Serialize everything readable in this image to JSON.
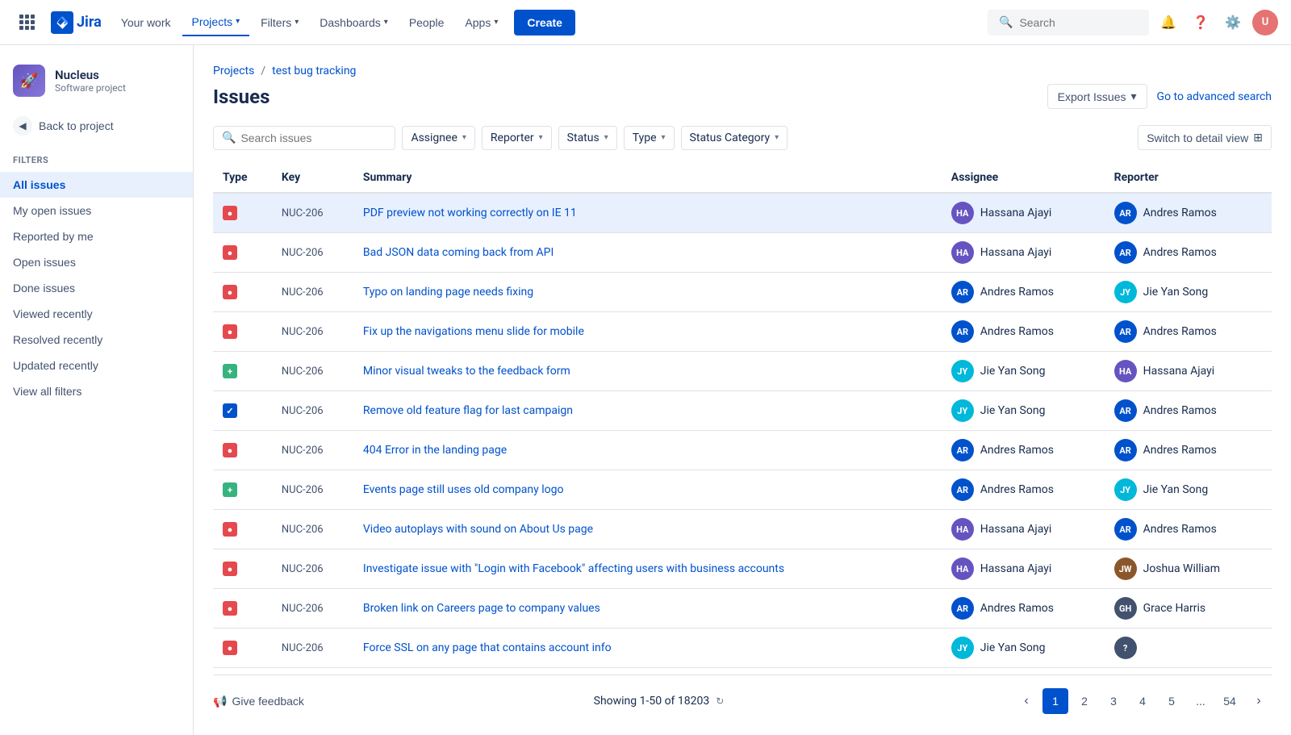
{
  "topnav": {
    "logo_text": "Jira",
    "nav_items": [
      {
        "label": "Your work",
        "active": false
      },
      {
        "label": "Projects",
        "active": true,
        "has_dropdown": true
      },
      {
        "label": "Filters",
        "active": false,
        "has_dropdown": true
      },
      {
        "label": "Dashboards",
        "active": false,
        "has_dropdown": true
      },
      {
        "label": "People",
        "active": false
      },
      {
        "label": "Apps",
        "active": false,
        "has_dropdown": true
      }
    ],
    "create_label": "Create",
    "search_placeholder": "Search",
    "search_label": "Search"
  },
  "sidebar": {
    "project_name": "Nucleus",
    "project_type": "Software project",
    "back_label": "Back to project",
    "section_label": "Filters",
    "items": [
      {
        "label": "All issues",
        "active": true
      },
      {
        "label": "My open issues",
        "active": false
      },
      {
        "label": "Reported by me",
        "active": false
      },
      {
        "label": "Open issues",
        "active": false
      },
      {
        "label": "Done issues",
        "active": false
      },
      {
        "label": "Viewed recently",
        "active": false
      },
      {
        "label": "Resolved recently",
        "active": false
      },
      {
        "label": "Updated recently",
        "active": false
      },
      {
        "label": "View all filters",
        "active": false
      }
    ]
  },
  "breadcrumb": {
    "items": [
      {
        "label": "Projects",
        "href": true
      },
      {
        "label": "test bug tracking",
        "href": true
      }
    ]
  },
  "page": {
    "title": "Issues",
    "export_label": "Export Issues",
    "advanced_search_label": "Go to advanced search"
  },
  "filters": {
    "search_placeholder": "Search issues",
    "assignee_label": "Assignee",
    "reporter_label": "Reporter",
    "status_label": "Status",
    "type_label": "Type",
    "status_category_label": "Status Category",
    "switch_view_label": "Switch to detail view"
  },
  "table": {
    "columns": [
      "Type",
      "Key",
      "Summary",
      "Assignee",
      "Reporter"
    ],
    "rows": [
      {
        "type": "bug",
        "type_label": "B",
        "key": "NUC-206",
        "summary": "PDF preview not working correctly on IE 11",
        "assignee": "Hassana Ajayi",
        "assignee_initials": "HA",
        "assignee_color": "av-purple",
        "reporter": "Andres Ramos",
        "reporter_initials": "AR",
        "reporter_color": "av-blue",
        "selected": true
      },
      {
        "type": "bug",
        "type_label": "B",
        "key": "NUC-206",
        "summary": "Bad JSON data coming back from API",
        "assignee": "Hassana Ajayi",
        "assignee_initials": "HA",
        "assignee_color": "av-purple",
        "reporter": "Andres Ramos",
        "reporter_initials": "AR",
        "reporter_color": "av-blue",
        "selected": false
      },
      {
        "type": "bug",
        "type_label": "B",
        "key": "NUC-206",
        "summary": "Typo on landing page needs fixing",
        "assignee": "Andres Ramos",
        "assignee_initials": "AR",
        "assignee_color": "av-blue",
        "reporter": "Jie Yan Song",
        "reporter_initials": "JY",
        "reporter_color": "av-teal",
        "selected": false
      },
      {
        "type": "bug",
        "type_label": "B",
        "key": "NUC-206",
        "summary": "Fix up the navigations menu slide for mobile",
        "assignee": "Andres Ramos",
        "assignee_initials": "AR",
        "assignee_color": "av-blue",
        "reporter": "Andres Ramos",
        "reporter_initials": "AR",
        "reporter_color": "av-blue",
        "selected": false
      },
      {
        "type": "improvement",
        "type_label": "+",
        "key": "NUC-206",
        "summary": "Minor visual tweaks to the feedback form",
        "assignee": "Jie Yan Song",
        "assignee_initials": "JY",
        "assignee_color": "av-teal",
        "reporter": "Hassana Ajayi",
        "reporter_initials": "HA",
        "reporter_color": "av-purple",
        "selected": false
      },
      {
        "type": "check",
        "type_label": "✓",
        "key": "NUC-206",
        "summary": "Remove old feature flag for last campaign",
        "assignee": "Jie Yan Song",
        "assignee_initials": "JY",
        "assignee_color": "av-teal",
        "reporter": "Andres Ramos",
        "reporter_initials": "AR",
        "reporter_color": "av-blue",
        "selected": false
      },
      {
        "type": "bug",
        "type_label": "B",
        "key": "NUC-206",
        "summary": "404 Error in the landing page",
        "assignee": "Andres Ramos",
        "assignee_initials": "AR",
        "assignee_color": "av-blue",
        "reporter": "Andres Ramos",
        "reporter_initials": "AR",
        "reporter_color": "av-blue",
        "selected": false
      },
      {
        "type": "improvement",
        "type_label": "+",
        "key": "NUC-206",
        "summary": "Events page still uses old company logo",
        "assignee": "Andres Ramos",
        "assignee_initials": "AR",
        "assignee_color": "av-blue",
        "reporter": "Jie Yan Song",
        "reporter_initials": "JY",
        "reporter_color": "av-teal",
        "selected": false
      },
      {
        "type": "bug",
        "type_label": "B",
        "key": "NUC-206",
        "summary": "Video autoplays with sound on About Us page",
        "assignee": "Hassana Ajayi",
        "assignee_initials": "HA",
        "assignee_color": "av-purple",
        "reporter": "Andres Ramos",
        "reporter_initials": "AR",
        "reporter_color": "av-blue",
        "selected": false
      },
      {
        "type": "bug",
        "type_label": "B",
        "key": "NUC-206",
        "summary": "Investigate issue with \"Login with Facebook\" affecting users with business accounts",
        "assignee": "Hassana Ajayi",
        "assignee_initials": "HA",
        "assignee_color": "av-purple",
        "reporter": "Joshua William",
        "reporter_initials": "JW",
        "reporter_color": "av-brown",
        "selected": false
      },
      {
        "type": "bug",
        "type_label": "B",
        "key": "NUC-206",
        "summary": "Broken link on Careers page to company values",
        "assignee": "Andres Ramos",
        "assignee_initials": "AR",
        "assignee_color": "av-blue",
        "reporter": "Grace Harris",
        "reporter_initials": "GH",
        "reporter_color": "av-gray",
        "selected": false
      },
      {
        "type": "bug",
        "type_label": "B",
        "key": "NUC-206",
        "summary": "Force SSL on any page that contains account info",
        "assignee": "Jie Yan Song",
        "assignee_initials": "JY",
        "assignee_color": "av-teal",
        "reporter": "",
        "reporter_initials": "?",
        "reporter_color": "av-gray",
        "selected": false
      }
    ]
  },
  "pagination": {
    "feedback_label": "Give feedback",
    "showing_text": "Showing 1-50 of 18203",
    "pages": [
      "1",
      "2",
      "3",
      "4",
      "5",
      "...",
      "54"
    ],
    "current_page": "1"
  }
}
